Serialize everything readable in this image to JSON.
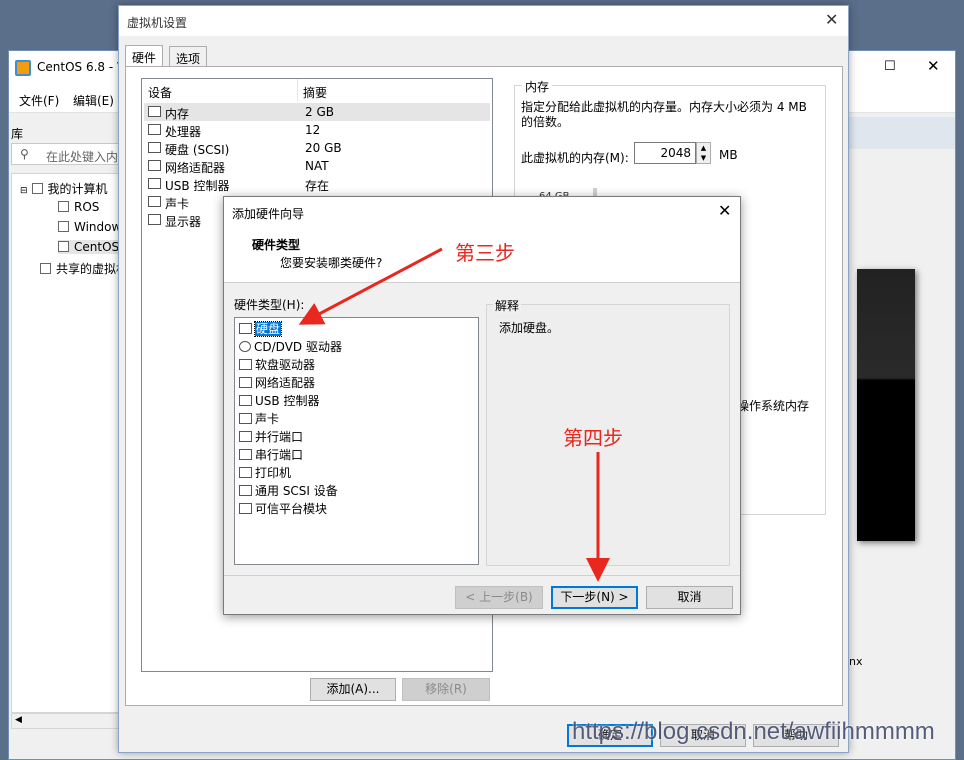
{
  "main_window": {
    "title": "CentOS 6.8 - V",
    "menu": [
      "文件(F)",
      "编辑(E)"
    ],
    "library_label": "库",
    "search_placeholder": "在此处键入内容",
    "tree": [
      "我的计算机",
      "ROS",
      "Window",
      "CentOS",
      "共享的虚拟机"
    ],
    "right_text": "nx"
  },
  "settings": {
    "title": "虚拟机设置",
    "tabs": [
      "硬件",
      "选项"
    ],
    "col_device": "设备",
    "col_summary": "摘要",
    "devices": [
      {
        "name": "内存",
        "value": "2 GB",
        "icon": "memory-icon"
      },
      {
        "name": "处理器",
        "value": "12",
        "icon": "cpu-icon"
      },
      {
        "name": "硬盘 (SCSI)",
        "value": "20 GB",
        "icon": "harddisk-icon"
      },
      {
        "name": "网络适配器",
        "value": "NAT",
        "icon": "network-icon"
      },
      {
        "name": "USB 控制器",
        "value": "存在",
        "icon": "usb-icon"
      },
      {
        "name": "声卡",
        "value": "",
        "icon": "sound-icon"
      },
      {
        "name": "显示器",
        "value": "",
        "icon": "display-icon"
      }
    ],
    "memory": {
      "legend": "内存",
      "desc": "指定分配给此虚拟机的内存量。内存大小必须为 4 MB 的倍数。",
      "label": "此虚拟机的内存(M):",
      "value": "2048",
      "unit": "MB",
      "max_tick": "64 GB",
      "os_text": "操作系统内存"
    },
    "add_button": "添加(A)...",
    "remove_button": "移除(R)",
    "ok_button": "确定",
    "cancel_button": "取消",
    "help_button": "帮助"
  },
  "wizard": {
    "title": "添加硬件向导",
    "head_title": "硬件类型",
    "head_sub": "您要安装哪类硬件?",
    "list_label": "硬件类型(H):",
    "items": [
      {
        "name": "硬盘",
        "icon": "harddisk-icon"
      },
      {
        "name": "CD/DVD 驱动器",
        "icon": "cdrom-icon"
      },
      {
        "name": "软盘驱动器",
        "icon": "floppy-icon"
      },
      {
        "name": "网络适配器",
        "icon": "network-icon"
      },
      {
        "name": "USB 控制器",
        "icon": "usb-icon"
      },
      {
        "name": "声卡",
        "icon": "sound-icon"
      },
      {
        "name": "并行端口",
        "icon": "parallel-port-icon"
      },
      {
        "name": "串行端口",
        "icon": "serial-port-icon"
      },
      {
        "name": "打印机",
        "icon": "printer-icon"
      },
      {
        "name": "通用 SCSI 设备",
        "icon": "scsi-icon"
      },
      {
        "name": "可信平台模块",
        "icon": "tpm-icon"
      }
    ],
    "explain_legend": "解释",
    "explain_text": "添加硬盘。",
    "back_button": "< 上一步(B)",
    "next_button": "下一步(N) >",
    "cancel_button": "取消"
  },
  "annotations": {
    "step3": "第三步",
    "step4": "第四步",
    "color": "#e8281f"
  },
  "watermark": "https://blog.csdn.net/awfiihmmmm"
}
